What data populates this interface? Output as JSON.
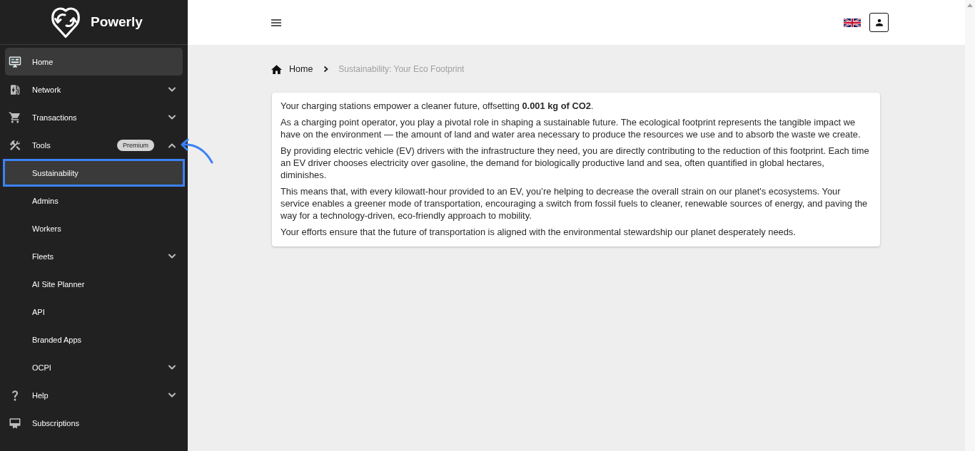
{
  "logo": {
    "name": "Powerly"
  },
  "sidebar": {
    "items": [
      {
        "label": "Home",
        "kind": "link",
        "selected": true,
        "pointed": false
      },
      {
        "label": "Network",
        "kind": "group",
        "selected": false,
        "expanded": false,
        "pointed": false
      },
      {
        "label": "Transactions",
        "kind": "group",
        "selected": false,
        "expanded": false,
        "pointed": false
      },
      {
        "label": "Tools",
        "kind": "group",
        "selected": false,
        "expanded": true,
        "pointed": true,
        "badge": "Premium",
        "children": [
          {
            "label": "Sustainability",
            "kind": "link",
            "selected": true,
            "outlined": true
          },
          {
            "label": "Admins",
            "kind": "link",
            "selected": false,
            "outlined": false
          },
          {
            "label": "Workers",
            "kind": "link",
            "selected": false,
            "outlined": false
          },
          {
            "label": "Fleets",
            "kind": "group",
            "selected": false,
            "expanded": false,
            "outlined": false
          },
          {
            "label": "AI Site Planner",
            "kind": "link",
            "selected": false,
            "outlined": false
          },
          {
            "label": "API",
            "kind": "link",
            "selected": false,
            "outlined": false
          },
          {
            "label": "Branded Apps",
            "kind": "link",
            "selected": false,
            "outlined": false
          },
          {
            "label": "OCPI",
            "kind": "group",
            "selected": false,
            "expanded": false,
            "outlined": false
          }
        ]
      },
      {
        "label": "Help",
        "kind": "group",
        "selected": false,
        "expanded": false,
        "pointed": false
      },
      {
        "label": "Subscriptions",
        "kind": "link",
        "selected": false,
        "pointed": false
      }
    ]
  },
  "breadcrumb": [
    {
      "label": "Home",
      "kind": "link"
    },
    {
      "label": "Sustainability: Your Eco Footprint",
      "kind": "current"
    }
  ],
  "card": {
    "paragraphs": [
      "Your charging stations empower a cleaner future, offsetting **0.001 kg of CO2**.",
      "As a charging point operator, you play a pivotal role in shaping a sustainable future. The ecological footprint represents the tangible impact we have on the environment — the amount of land and water area necessary to produce the resources we use and to absorb the waste we create.",
      "By providing electric vehicle (EV) drivers with the infrastructure they need, you are directly contributing to the reduction of this footprint. Each time an EV driver chooses electricity over gasoline, the demand for biologically productive land and sea, often quantified in global hectares, diminishes.",
      "This means that, with every kilowatt-hour provided to an EV, you’re helping to decrease the overall strain on our planet's ecosystems. Your service enables a greener mode of transportation, encouraging a switch from fossil fuels to cleaner, renewable sources of energy, and paving the way for a technology-driven, eco-friendly approach to mobility.",
      "Your efforts ensure that the future of transportation is aligned with the environmental stewardship our planet desperately needs."
    ]
  }
}
